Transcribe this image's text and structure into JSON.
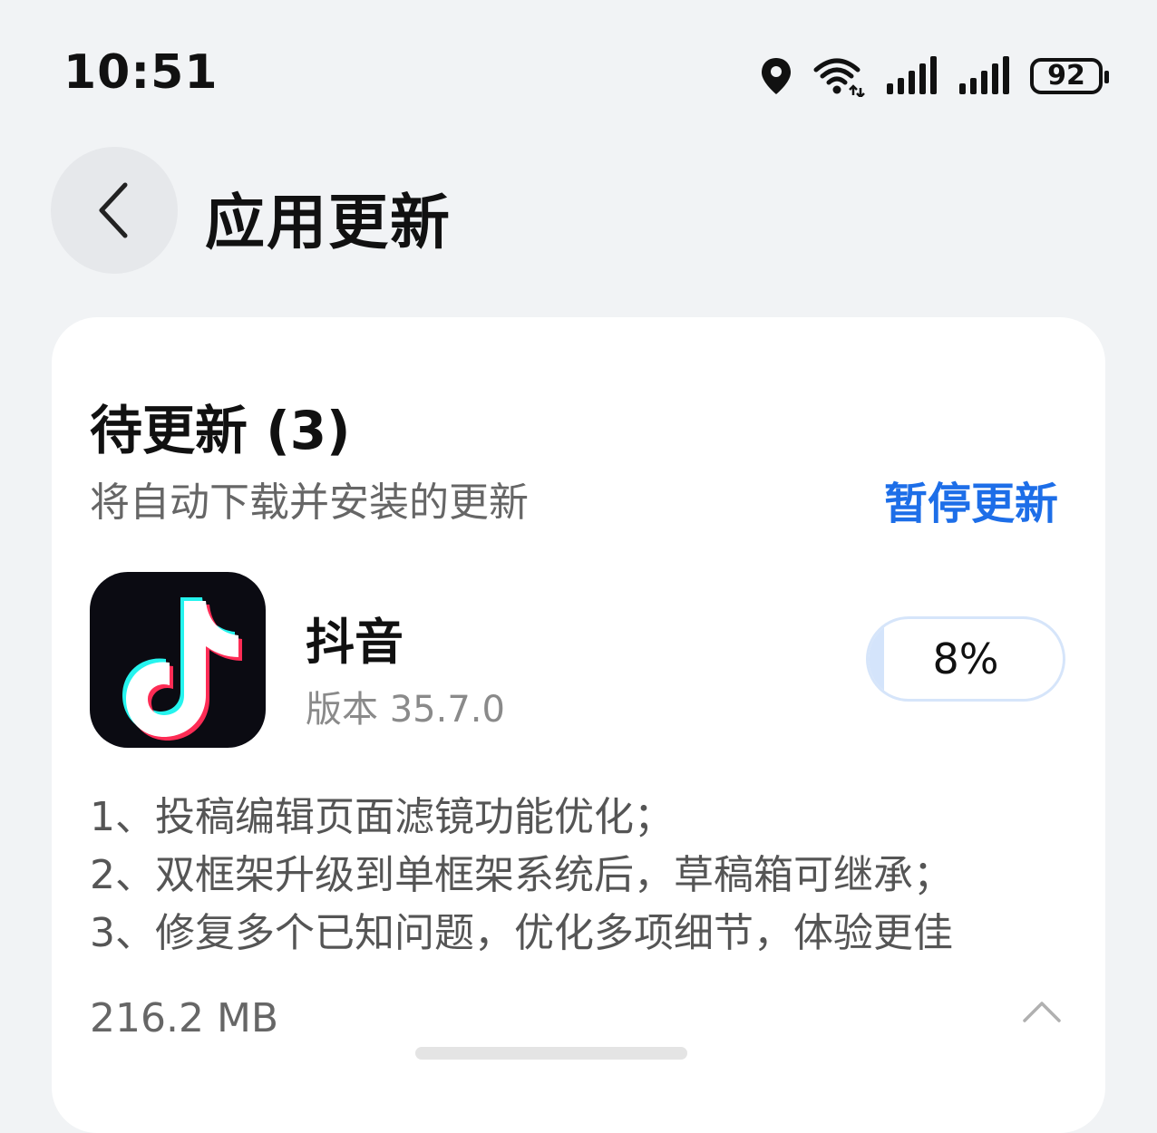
{
  "status_bar": {
    "time": "10:51",
    "battery": "92",
    "icons": [
      "location-icon",
      "wifi-icon",
      "signal-icon",
      "signal-icon",
      "battery-icon"
    ]
  },
  "header": {
    "title": "应用更新",
    "back_icon": "chevron-left-icon"
  },
  "pending": {
    "title": "待更新 (3)",
    "subtitle": "将自动下载并安装的更新",
    "pause_label": "暂停更新",
    "accent_color": "#1d6ee8"
  },
  "app": {
    "name": "抖音",
    "version": "版本 35.7.0",
    "progress_label": "8%",
    "progress_value": 0.08,
    "icon": "tiktok-logo",
    "notes": [
      "1、投稿编辑页面滤镜功能优化；",
      "2、双框架升级到单框架系统后，草稿箱可继承；",
      "3、修复多个已知问题，优化多项细节，体验更佳"
    ],
    "size": "216.2 MB",
    "collapse_icon": "chevron-up-icon"
  }
}
